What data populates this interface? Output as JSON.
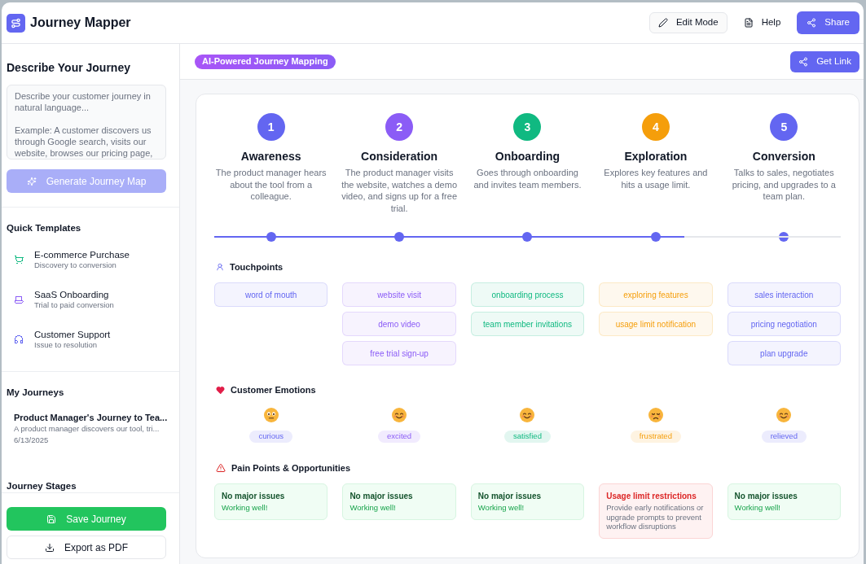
{
  "app": {
    "title": "Journey Mapper"
  },
  "toolbar": {
    "buttons": [
      {
        "label": "Edit Mode",
        "kind": "outline"
      },
      {
        "label": "Help",
        "kind": "plain"
      },
      {
        "label": "Share",
        "kind": "primary"
      }
    ]
  },
  "sidebar": {
    "describe": {
      "heading": "Describe Your Journey",
      "input": {
        "placeholder": "Describe your customer journey in natural language...\n\nExample: A customer discovers us through Google search, visits our website, browses our pricing page,"
      },
      "generate_button": {
        "label": "Generate Journey Map",
        "disabled": true
      }
    },
    "quick_templates": {
      "heading": "Quick Templates",
      "items": [
        {
          "title": "E-commerce Purchase",
          "subtitle": "Discovery to conversion",
          "color": "#10b981"
        },
        {
          "title": "SaaS Onboarding",
          "subtitle": "Trial to paid conversion",
          "color": "#8b5cf6"
        },
        {
          "title": "Customer Support",
          "subtitle": "Issue to resolution",
          "color": "#6366f1"
        }
      ]
    },
    "my_journeys": {
      "heading": "My Journeys",
      "items": [
        {
          "title": "Product Manager's Journey to Tea...",
          "description": "A product manager discovers our tool, tri...",
          "date": "6/13/2025"
        }
      ]
    },
    "journey_stages": {
      "heading": "Journey Stages"
    },
    "footer_buttons": [
      {
        "label": "Save Journey",
        "kind": "primary"
      },
      {
        "label": "Export as PDF",
        "kind": "outline"
      }
    ]
  },
  "main": {
    "badge": "AI-Powered Journey Mapping",
    "get_link_button": {
      "label": "Get Link"
    },
    "stages": [
      {
        "number": "1",
        "title": "Awareness",
        "description": "The product manager hears about the tool from a colleague.",
        "color": "#6366f1"
      },
      {
        "number": "2",
        "title": "Consideration",
        "description": "The product manager visits the website, watches a demo video, and signs up for a free trial.",
        "color": "#8b5cf6"
      },
      {
        "number": "3",
        "title": "Onboarding",
        "description": "Goes through onboarding and invites team members.",
        "color": "#10b981"
      },
      {
        "number": "4",
        "title": "Exploration",
        "description": "Explores key features and hits a usage limit.",
        "color": "#f59e0b"
      },
      {
        "number": "5",
        "title": "Conversion",
        "description": "Talks to sales, negotiates pricing, and upgrades to a team plan.",
        "color": "#6366f1"
      }
    ],
    "timeline": {
      "level": 0.75
    },
    "touchpoints": {
      "heading": "Touchpoints",
      "columns": [
        {
          "items": [
            "word of mouth"
          ]
        },
        {
          "items": [
            "website visit",
            "demo video",
            "free trial sign-up"
          ]
        },
        {
          "items": [
            "onboarding process",
            "team member invitations"
          ]
        },
        {
          "items": [
            "exploring features",
            "usage limit notification"
          ]
        },
        {
          "items": [
            "sales interaction",
            "pricing negotiation",
            "plan upgrade"
          ]
        }
      ]
    },
    "emotions": {
      "heading": "Customer Emotions",
      "items": [
        {
          "label": "curious",
          "kind": "neutral"
        },
        {
          "label": "excited",
          "kind": "smile"
        },
        {
          "label": "satisfied",
          "kind": "smile"
        },
        {
          "label": "frustrated",
          "kind": "sad"
        },
        {
          "label": "relieved",
          "kind": "smile"
        }
      ]
    },
    "pain_points": {
      "heading": "Pain Points & Opportunities",
      "items": [
        {
          "kind": "ok",
          "title": "No major issues",
          "note": "Working well!"
        },
        {
          "kind": "ok",
          "title": "No major issues",
          "note": "Working well!"
        },
        {
          "kind": "ok",
          "title": "No major issues",
          "note": "Working well!"
        },
        {
          "kind": "issue",
          "title": "Usage limit restrictions",
          "note": "Provide early notifications or upgrade prompts to prevent workflow disruptions"
        },
        {
          "kind": "ok",
          "title": "No major issues",
          "note": "Working well!"
        }
      ]
    }
  }
}
